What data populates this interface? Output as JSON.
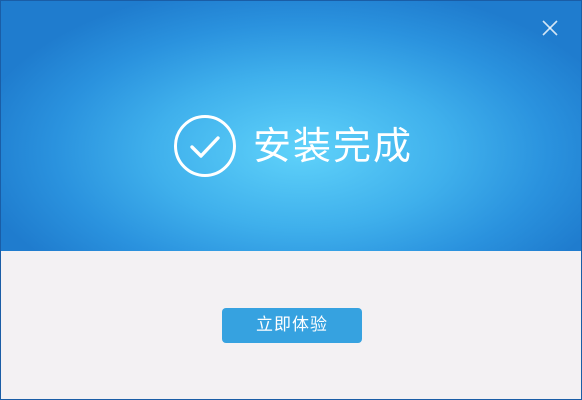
{
  "dialog": {
    "title": "安装完成",
    "action_label": "立即体验",
    "close_icon": "close-icon",
    "status_icon": "check-circle-icon"
  },
  "colors": {
    "banner_center": "#5fd2fa",
    "banner_edge": "#1f7cce",
    "footer_bg": "#f3f1f3",
    "button_bg": "#36a2e0",
    "text_on_blue": "#ffffff"
  }
}
